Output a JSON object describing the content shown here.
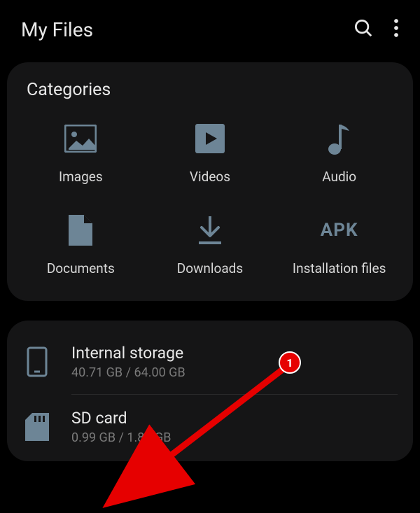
{
  "header": {
    "title": "My Files"
  },
  "categories": {
    "title": "Categories",
    "items": [
      {
        "label": "Images"
      },
      {
        "label": "Videos"
      },
      {
        "label": "Audio"
      },
      {
        "label": "Documents"
      },
      {
        "label": "Downloads"
      },
      {
        "label": "Installation files"
      }
    ],
    "apk_label": "APK"
  },
  "storage": {
    "internal": {
      "title": "Internal storage",
      "sub": "40.71 GB / 64.00 GB"
    },
    "sdcard": {
      "title": "SD card",
      "sub": "0.99 GB / 1.86 GB"
    }
  },
  "annotation": {
    "badge_number": "1"
  }
}
